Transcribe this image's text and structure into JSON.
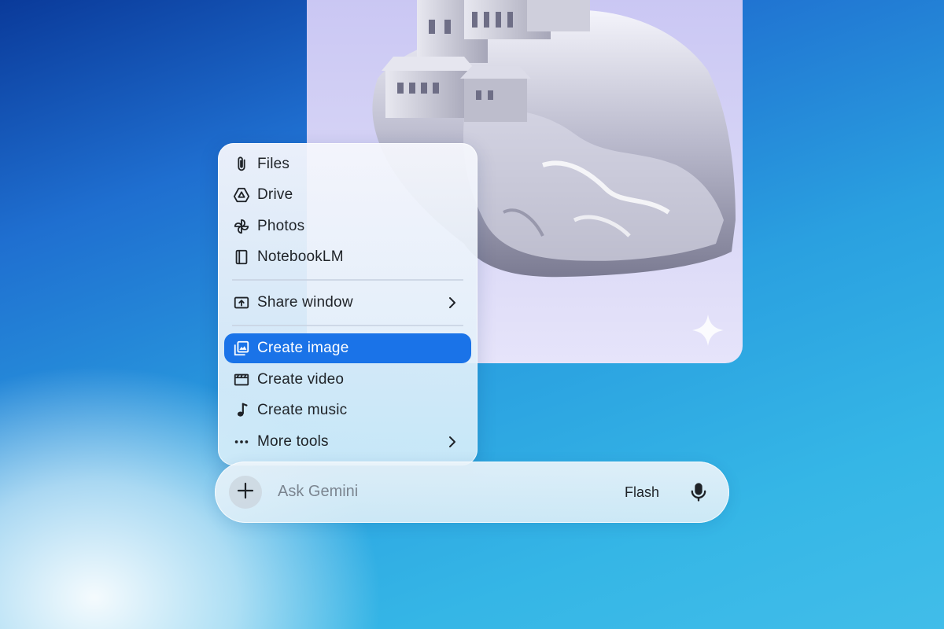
{
  "menu": {
    "items": [
      {
        "label": "Files",
        "icon": "paperclip-icon"
      },
      {
        "label": "Drive",
        "icon": "drive-icon"
      },
      {
        "label": "Photos",
        "icon": "pinwheel-icon"
      },
      {
        "label": "NotebookLM",
        "icon": "notebook-icon"
      },
      {
        "label": "Share window",
        "icon": "share-window-icon"
      },
      {
        "label": "Create image",
        "icon": "image-stack-icon",
        "selected": true
      },
      {
        "label": "Create video",
        "icon": "clapperboard-icon"
      },
      {
        "label": "Create music",
        "icon": "music-note-icon"
      },
      {
        "label": "More tools",
        "icon": "more-dots-icon"
      }
    ]
  },
  "input_bar": {
    "placeholder": "Ask Gemini",
    "model_label": "Flash"
  },
  "colors": {
    "accent": "#1a73e8",
    "background_dark": "#0a3a9a",
    "background_light": "#41bde9"
  }
}
